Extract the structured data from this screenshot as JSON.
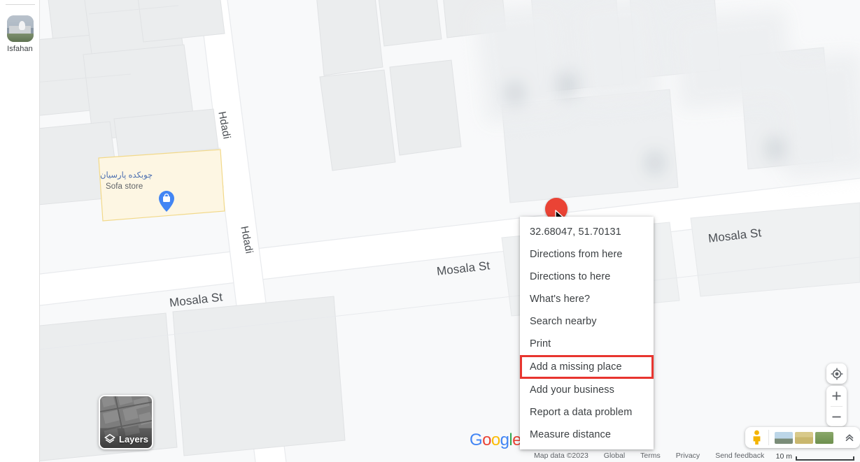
{
  "app": {
    "name": "Google Maps",
    "logo_text": "Google"
  },
  "sidebar": {
    "items": [
      {
        "label": "Isfahan",
        "icon": "place-thumbnail-icon"
      }
    ]
  },
  "map": {
    "labels": [
      {
        "text": "Hdadi",
        "kind": "street"
      },
      {
        "text": "Hdadi",
        "kind": "street"
      },
      {
        "text": "Mosala St",
        "kind": "street-large"
      },
      {
        "text": "Mosala St",
        "kind": "street-large"
      },
      {
        "text": "Mosala St",
        "kind": "street-large"
      }
    ],
    "poi": {
      "name_fa": "چوبکده پارسیان",
      "name_en": "Sofa store",
      "icon": "shopping-bag-pin-icon"
    },
    "marker": {
      "icon": "red-circle-marker",
      "color": "#ea4335"
    },
    "cursor": {
      "icon": "mouse-pointer-icon"
    }
  },
  "context_menu": {
    "items": [
      {
        "label": "32.68047, 51.70131",
        "name": "coordinates",
        "highlighted": false
      },
      {
        "label": "Directions from here",
        "name": "directions-from-here",
        "highlighted": false
      },
      {
        "label": "Directions to here",
        "name": "directions-to-here",
        "highlighted": false
      },
      {
        "label": "What's here?",
        "name": "whats-here",
        "highlighted": false
      },
      {
        "label": "Search nearby",
        "name": "search-nearby",
        "highlighted": false
      },
      {
        "label": "Print",
        "name": "print",
        "highlighted": false
      },
      {
        "label": "Add a missing place",
        "name": "add-a-missing-place",
        "highlighted": true
      },
      {
        "label": "Add your business",
        "name": "add-your-business",
        "highlighted": false
      },
      {
        "label": "Report a data problem",
        "name": "report-a-data-problem",
        "highlighted": false
      },
      {
        "label": "Measure distance",
        "name": "measure-distance",
        "highlighted": false
      }
    ],
    "highlight_color": "#e8352f"
  },
  "layers": {
    "label": "Layers",
    "icon": "layers-diamond-icon"
  },
  "controls": {
    "locate": {
      "icon": "my-location-icon",
      "label": ""
    },
    "zoom_in": {
      "icon": "plus-icon",
      "label": "+"
    },
    "zoom_out": {
      "icon": "minus-icon",
      "label": "−"
    },
    "pegman": {
      "icon": "pegman-icon"
    },
    "expand": {
      "icon": "chevron-double-up-icon",
      "label": "⌃"
    }
  },
  "footer": {
    "map_data": "Map data ©2023",
    "global": "Global",
    "terms": "Terms",
    "privacy": "Privacy",
    "send_feedback": "Send feedback",
    "scale_label": "10 m"
  }
}
